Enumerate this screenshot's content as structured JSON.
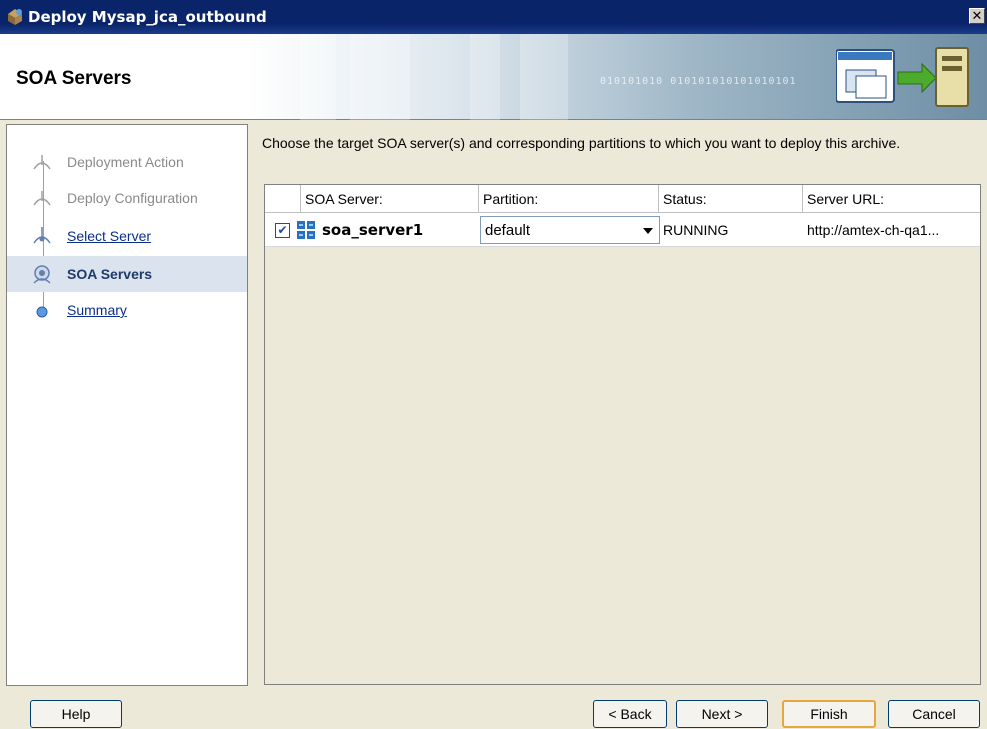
{
  "window": {
    "title": "Deploy Mysap_jca_outbound",
    "close_symbol": "✕",
    "app_icon": "deploy-icon"
  },
  "header": {
    "page_title": "SOA Servers",
    "decoration_bits": "010101010 010101010101010101",
    "icon": "deploy-server-icon"
  },
  "steps": [
    {
      "label": "Deployment Action",
      "state": "done"
    },
    {
      "label": "Deploy Configuration",
      "state": "done"
    },
    {
      "label": "Select Server",
      "state": "link"
    },
    {
      "label": "SOA Servers",
      "state": "active"
    },
    {
      "label": "Summary",
      "state": "link"
    }
  ],
  "main": {
    "instruction": "Choose the target SOA server(s) and corresponding partitions to which you want to deploy this archive.",
    "table": {
      "headers": [
        "SOA Server:",
        "Partition:",
        "Status:",
        "Server URL:"
      ],
      "rows": [
        {
          "checked": true,
          "check_glyph": "✔",
          "server": "soa_server1",
          "partition": "default",
          "status": "RUNNING",
          "url": "http://amtex-ch-qa1..."
        }
      ]
    }
  },
  "buttons": {
    "help": "Help",
    "back": "< Back",
    "next": "Next >",
    "finish": "Finish",
    "cancel": "Cancel"
  },
  "colors": {
    "titlebar": "#0a246a",
    "default_button_border": "#e6a73c",
    "active_step_bg": "#dbe3ee",
    "link": "#0a2f8a"
  }
}
